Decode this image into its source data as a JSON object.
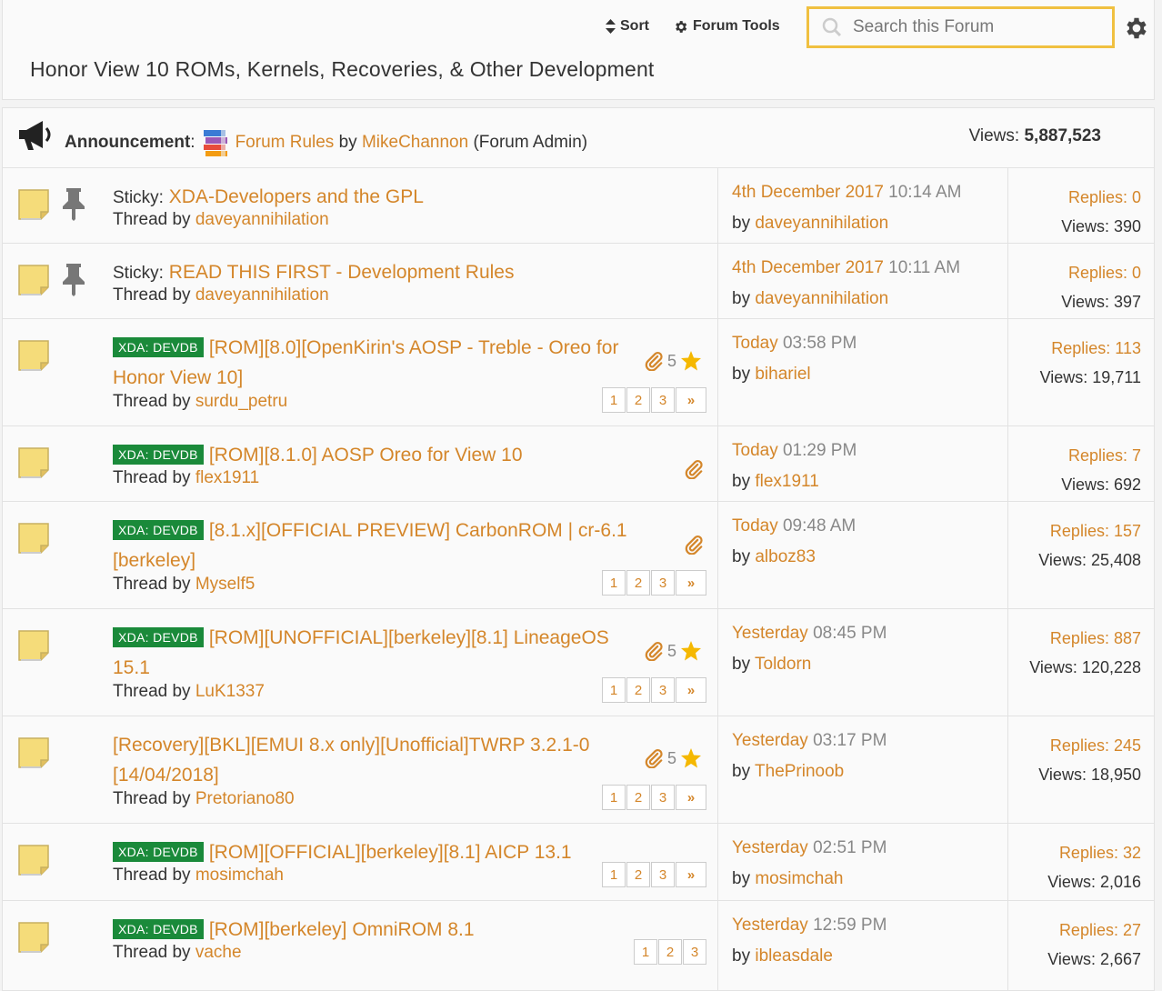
{
  "toolbar": {
    "sort_label": "Sort",
    "tools_label": "Forum Tools"
  },
  "search": {
    "placeholder": "Search this Forum"
  },
  "forum": {
    "title": "Honor View 10 ROMs, Kernels, Recoveries, & Other Development"
  },
  "announcement": {
    "label": "Announcement",
    "title": "Forum Rules",
    "by": "by",
    "author": "MikeChannon",
    "role": "(Forum Admin)",
    "views_label": "Views:",
    "views": "5,887,523"
  },
  "threads": [
    {
      "sticky": true,
      "prefix": "Sticky:",
      "badge": "",
      "title_1": "XDA-Developers and the GPL",
      "title_2": "",
      "starter_label": "Thread by",
      "starter": "daveyannihilation",
      "attach": false,
      "rating": "",
      "pages": [],
      "last_date": "4th December 2017",
      "last_time": "10:14 AM",
      "last_by_label": "by",
      "last_by": "daveyannihilation",
      "replies": "Replies: 0",
      "views": "Views: 390"
    },
    {
      "sticky": true,
      "prefix": "Sticky:",
      "badge": "",
      "title_1": "READ THIS FIRST - Development Rules",
      "title_2": "",
      "starter_label": "Thread by",
      "starter": "daveyannihilation",
      "attach": false,
      "rating": "",
      "pages": [],
      "last_date": "4th December 2017",
      "last_time": "10:11 AM",
      "last_by_label": "by",
      "last_by": "daveyannihilation",
      "replies": "Replies: 0",
      "views": "Views: 397"
    },
    {
      "sticky": false,
      "prefix": "",
      "badge": "XDA: DEVDB",
      "title_1": "[ROM][8.0][OpenKirin's AOSP - Treble - Oreo for",
      "title_2": "Honor View 10]",
      "starter_label": "Thread by",
      "starter": "surdu_petru",
      "attach": true,
      "rating": "5",
      "pages": [
        "1",
        "2",
        "3",
        "»"
      ],
      "last_date": "Today",
      "last_time": "03:58 PM",
      "last_by_label": "by",
      "last_by": "bihariel",
      "replies": "Replies: 113",
      "views": "Views: 19,711"
    },
    {
      "sticky": false,
      "prefix": "",
      "badge": "XDA: DEVDB",
      "title_1": "[ROM][8.1.0] AOSP Oreo for View 10",
      "title_2": "",
      "starter_label": "Thread by",
      "starter": "flex1911",
      "attach": true,
      "rating": "",
      "pages": [],
      "last_date": "Today",
      "last_time": "01:29 PM",
      "last_by_label": "by",
      "last_by": "flex1911",
      "replies": "Replies: 7",
      "views": "Views: 692"
    },
    {
      "sticky": false,
      "prefix": "",
      "badge": "XDA: DEVDB",
      "title_1": "[8.1.x][OFFICIAL PREVIEW] CarbonROM | cr-6.1",
      "title_2": "[berkeley]",
      "starter_label": "Thread by",
      "starter": "Myself5",
      "attach": true,
      "rating": "",
      "pages": [
        "1",
        "2",
        "3",
        "»"
      ],
      "last_date": "Today",
      "last_time": "09:48 AM",
      "last_by_label": "by",
      "last_by": "alboz83",
      "replies": "Replies: 157",
      "views": "Views: 25,408"
    },
    {
      "sticky": false,
      "prefix": "",
      "badge": "XDA: DEVDB",
      "title_1": "[ROM][UNOFFICIAL][berkeley][8.1] LineageOS",
      "title_2": "15.1",
      "starter_label": "Thread by",
      "starter": "LuK1337",
      "attach": true,
      "rating": "5",
      "pages": [
        "1",
        "2",
        "3",
        "»"
      ],
      "last_date": "Yesterday",
      "last_time": "08:45 PM",
      "last_by_label": "by",
      "last_by": "Toldorn",
      "replies": "Replies: 887",
      "views": "Views: 120,228"
    },
    {
      "sticky": false,
      "prefix": "",
      "badge": "",
      "title_1": "[Recovery][BKL][EMUI 8.x only][Unofficial]TWRP 3.2.1-0",
      "title_2": "[14/04/2018]",
      "starter_label": "Thread by",
      "starter": "Pretoriano80",
      "attach": true,
      "rating": "5",
      "pages": [
        "1",
        "2",
        "3",
        "»"
      ],
      "last_date": "Yesterday",
      "last_time": "03:17 PM",
      "last_by_label": "by",
      "last_by": "ThePrinoob",
      "replies": "Replies: 245",
      "views": "Views: 18,950"
    },
    {
      "sticky": false,
      "prefix": "",
      "badge": "XDA: DEVDB",
      "title_1": "[ROM][OFFICIAL][berkeley][8.1] AICP 13.1",
      "title_2": "",
      "starter_label": "Thread by",
      "starter": "mosimchah",
      "attach": false,
      "rating": "",
      "pages": [
        "1",
        "2",
        "3",
        "»"
      ],
      "last_date": "Yesterday",
      "last_time": "02:51 PM",
      "last_by_label": "by",
      "last_by": "mosimchah",
      "replies": "Replies: 32",
      "views": "Views: 2,016"
    },
    {
      "sticky": false,
      "prefix": "",
      "badge": "XDA: DEVDB",
      "title_1": "[ROM][berkeley] OmniROM 8.1",
      "title_2": "",
      "starter_label": "Thread by",
      "starter": "vache",
      "attach": false,
      "rating": "",
      "pages": [
        "1",
        "2",
        "3"
      ],
      "last_date": "Yesterday",
      "last_time": "12:59 PM",
      "last_by_label": "by",
      "last_by": "ibleasdale",
      "replies": "Replies: 27",
      "views": "Views: 2,667"
    }
  ]
}
